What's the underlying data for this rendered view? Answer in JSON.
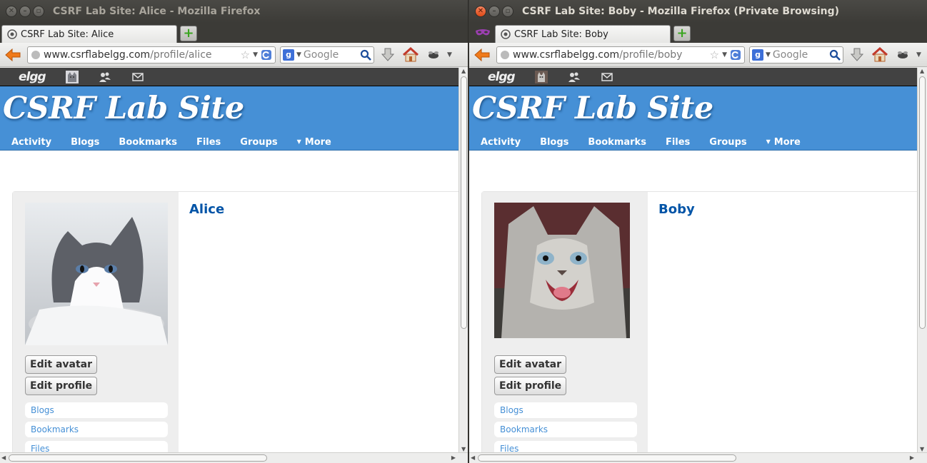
{
  "windows": [
    {
      "title": "CSRF Lab Site: Alice - Mozilla Firefox",
      "tab_label": "CSRF Lab Site: Alice",
      "url_host": "www.csrflabelgg.com",
      "url_path": "/profile/alice",
      "search_placeholder": "Google",
      "topbar_logo": "elgg",
      "site_title": "CSRF Lab Site",
      "menu": [
        "Activity",
        "Blogs",
        "Bookmarks",
        "Files",
        "Groups",
        "More"
      ],
      "profile_name": "Alice",
      "buttons": {
        "edit_avatar": "Edit avatar",
        "edit_profile": "Edit profile"
      },
      "owner_links": [
        "Blogs",
        "Bookmarks",
        "Files"
      ]
    },
    {
      "title": "CSRF Lab Site: Boby - Mozilla Firefox (Private Browsing)",
      "tab_label": "CSRF Lab Site: Boby",
      "url_host": "www.csrflabelgg.com",
      "url_path": "/profile/boby",
      "search_placeholder": "Google",
      "topbar_logo": "elgg",
      "site_title": "CSRF Lab Site",
      "menu": [
        "Activity",
        "Blogs",
        "Bookmarks",
        "Files",
        "Groups",
        "More"
      ],
      "profile_name": "Boby",
      "buttons": {
        "edit_avatar": "Edit avatar",
        "edit_profile": "Edit profile"
      },
      "owner_links": [
        "Blogs",
        "Bookmarks",
        "Files"
      ]
    }
  ],
  "colors": {
    "header_blue": "#4690d6",
    "link_blue": "#0054a7",
    "topbar": "#424242"
  },
  "icons": [
    "close-icon",
    "minimize-icon",
    "maximize-icon",
    "back-arrow-icon",
    "reload-icon",
    "bookmark-star-icon",
    "download-icon",
    "home-icon",
    "addon-icon",
    "search-icon",
    "private-browsing-icon"
  ]
}
